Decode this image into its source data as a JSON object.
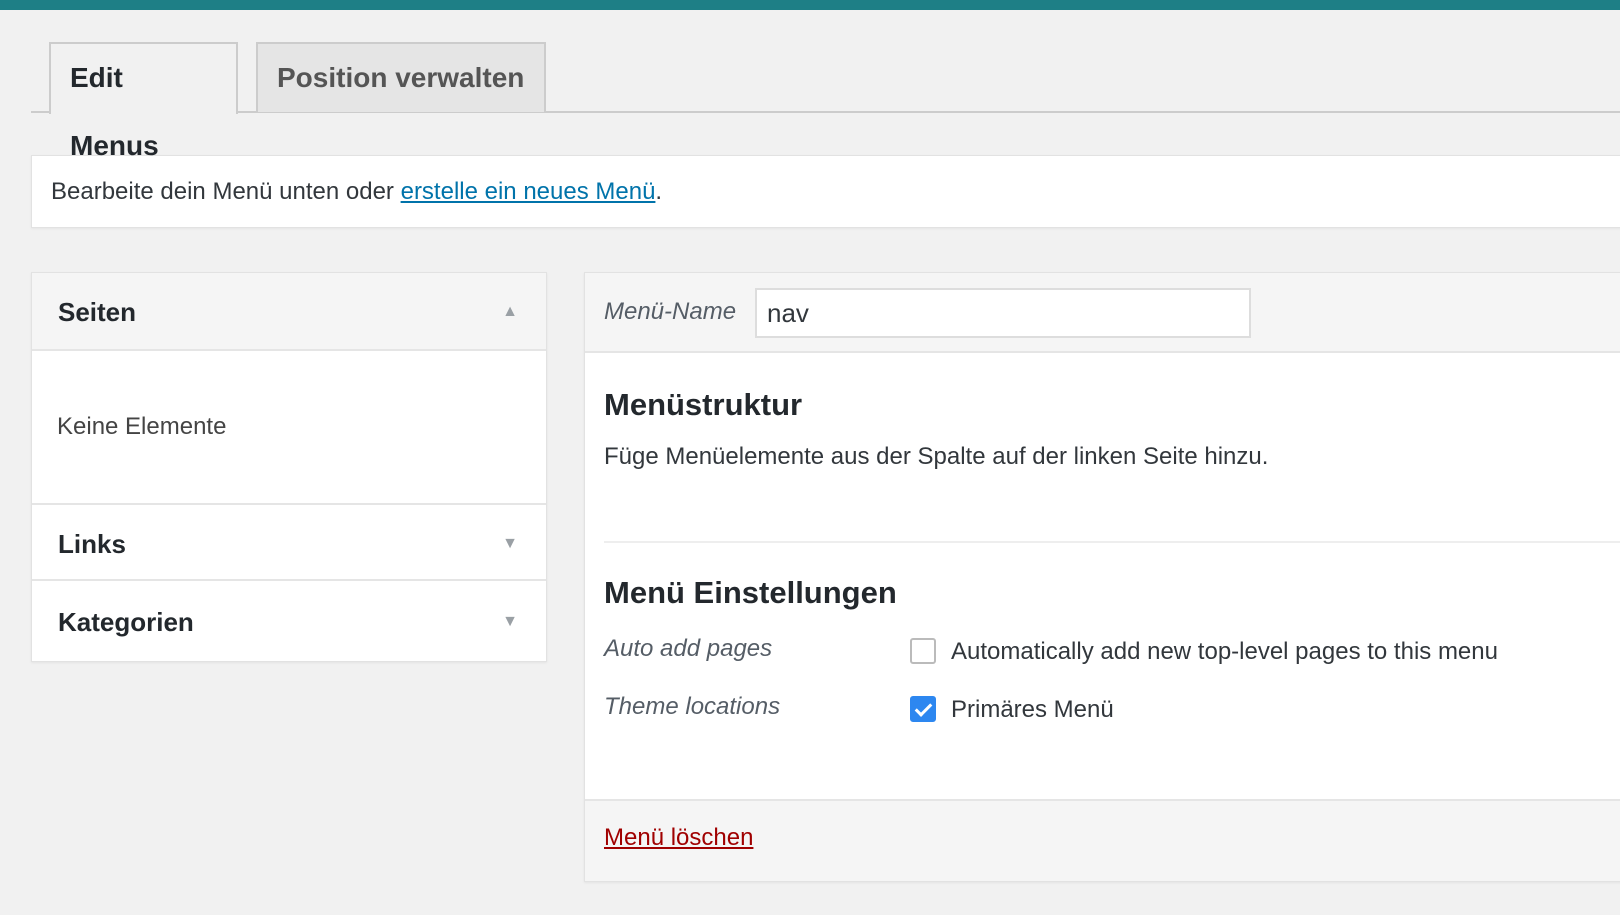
{
  "tabs": {
    "edit_menus": "Edit Menus",
    "manage_locations": "Position verwalten"
  },
  "notice": {
    "text": "Bearbeite dein Menü unten oder",
    "link": "erstelle ein neues Menü",
    "suffix": "."
  },
  "accordion": {
    "pages": {
      "title": "Seiten",
      "empty": "Keine Elemente"
    },
    "links": {
      "title": "Links"
    },
    "categories": {
      "title": "Kategorien"
    }
  },
  "editor": {
    "name_label": "Menü-Name",
    "name_value": "nav",
    "structure_title": "Menüstruktur",
    "structure_desc": "Füge Menüelemente aus der Spalte auf der linken Seite hinzu.",
    "settings_title": "Menü Einstellungen",
    "auto_add_label": "Auto add pages",
    "auto_add_text": "Automatically add new top-level pages to this menu",
    "auto_add_checked": false,
    "theme_locations_label": "Theme locations",
    "primary_menu_text": "Primäres Menü",
    "primary_menu_checked": true,
    "delete_link": "Menü löschen"
  },
  "icons": {
    "collapse": "triangle-up-icon",
    "expand": "triangle-down-icon",
    "checkmark": "checkmark-icon"
  },
  "colors": {
    "top_bar": "#1e7f86",
    "link": "#0073aa",
    "delete": "#a00000",
    "checkbox_checked": "#2d87f0"
  }
}
